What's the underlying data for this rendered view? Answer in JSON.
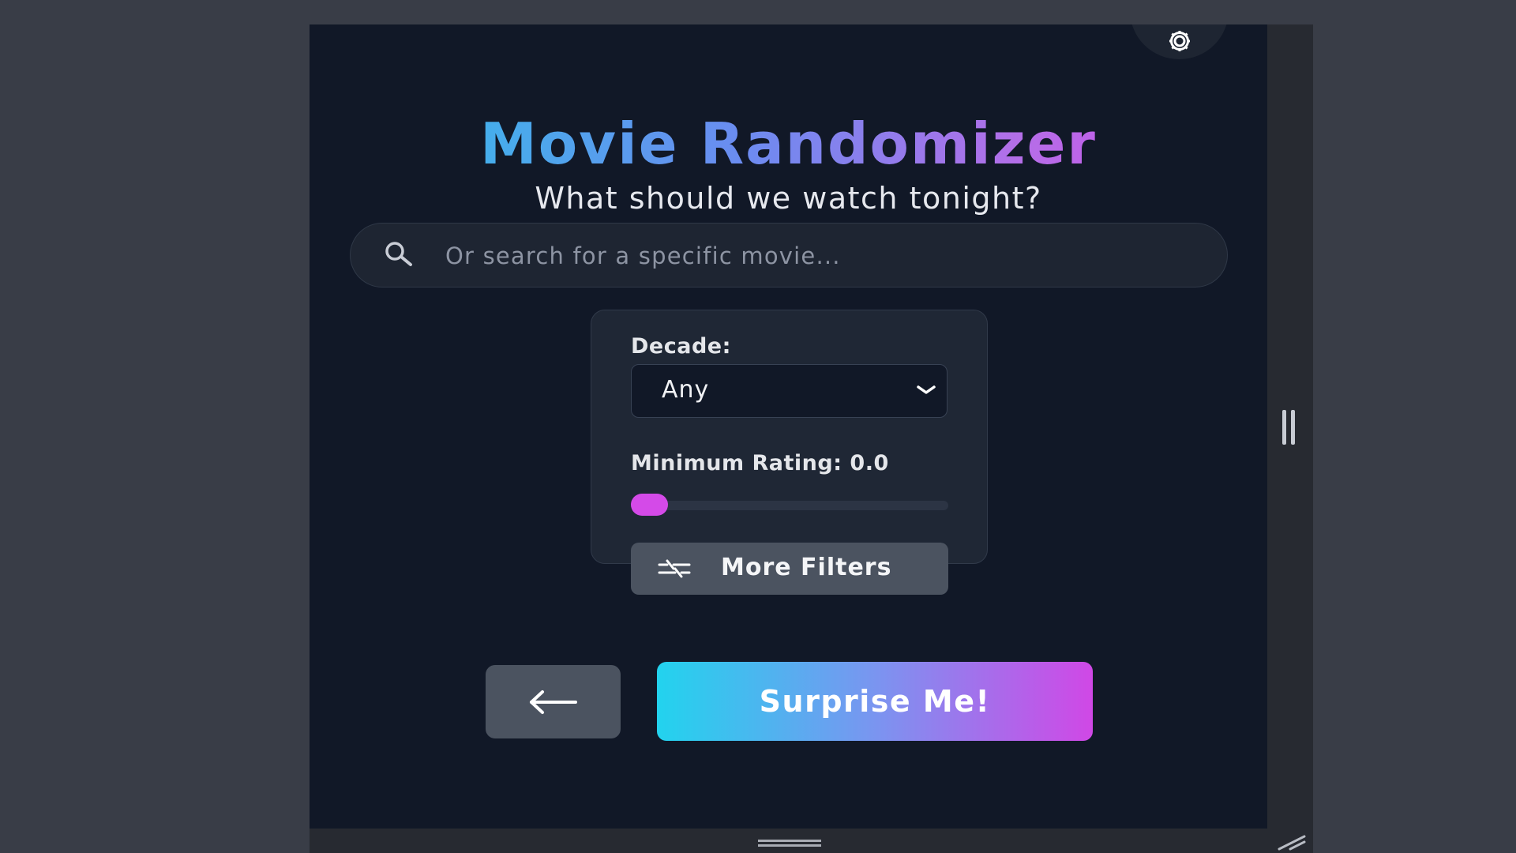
{
  "app": {
    "title": "Movie Randomizer",
    "subtitle": "What should we watch tonight?"
  },
  "search": {
    "placeholder": "Or search for a specific movie...",
    "value": ""
  },
  "filters": {
    "decade_label": "Decade:",
    "decade_value": "Any",
    "rating_label": "Minimum Rating: 0.0",
    "rating_value": 0.0,
    "more_filters_label": "More Filters"
  },
  "actions": {
    "back_icon": "arrow-left-icon",
    "surprise_label": "Surprise Me!"
  },
  "icons": {
    "settings": "gear-icon",
    "search": "search-icon",
    "decade_dropdown": "chevron-down-icon",
    "more_filters": "filter-sliders-icon"
  },
  "colors": {
    "background": "#111827",
    "panel": "#1f2735",
    "accent_start": "#22d3ee",
    "accent_end": "#d048e6",
    "slider_thumb": "#d44ae8",
    "secondary_button": "#4b5360"
  }
}
